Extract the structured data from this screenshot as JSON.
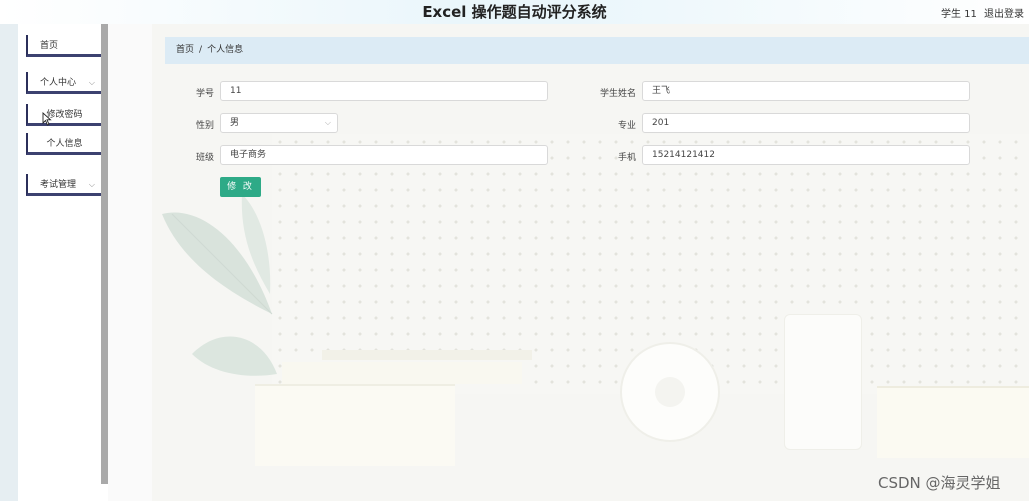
{
  "header": {
    "title": "Excel 操作题自动评分系统",
    "user": "学生 11",
    "logout": "退出登录"
  },
  "sidebar": {
    "items": [
      {
        "label": "首页"
      },
      {
        "label": "个人中心",
        "expanded": true
      },
      {
        "label": "修改密码"
      },
      {
        "label": "个人信息"
      },
      {
        "label": "考试管理",
        "expanded": false
      }
    ]
  },
  "breadcrumb": {
    "home": "首页",
    "separator": "/",
    "current": "个人信息"
  },
  "form": {
    "student_no": {
      "label": "学号",
      "value": "11"
    },
    "student_name": {
      "label": "学生姓名",
      "value": "王飞"
    },
    "gender": {
      "label": "性别",
      "value": "男"
    },
    "major": {
      "label": "专业",
      "value": "201"
    },
    "class": {
      "label": "班级",
      "value": "电子商务"
    },
    "phone": {
      "label": "手机",
      "value": "15214121412"
    },
    "submit": "修 改"
  },
  "colors": {
    "accent_button": "#2eaa87",
    "breadcrumb_bg": "#dcebf5",
    "menu_border": "#3c4170"
  },
  "watermark": "CSDN @海灵学姐"
}
